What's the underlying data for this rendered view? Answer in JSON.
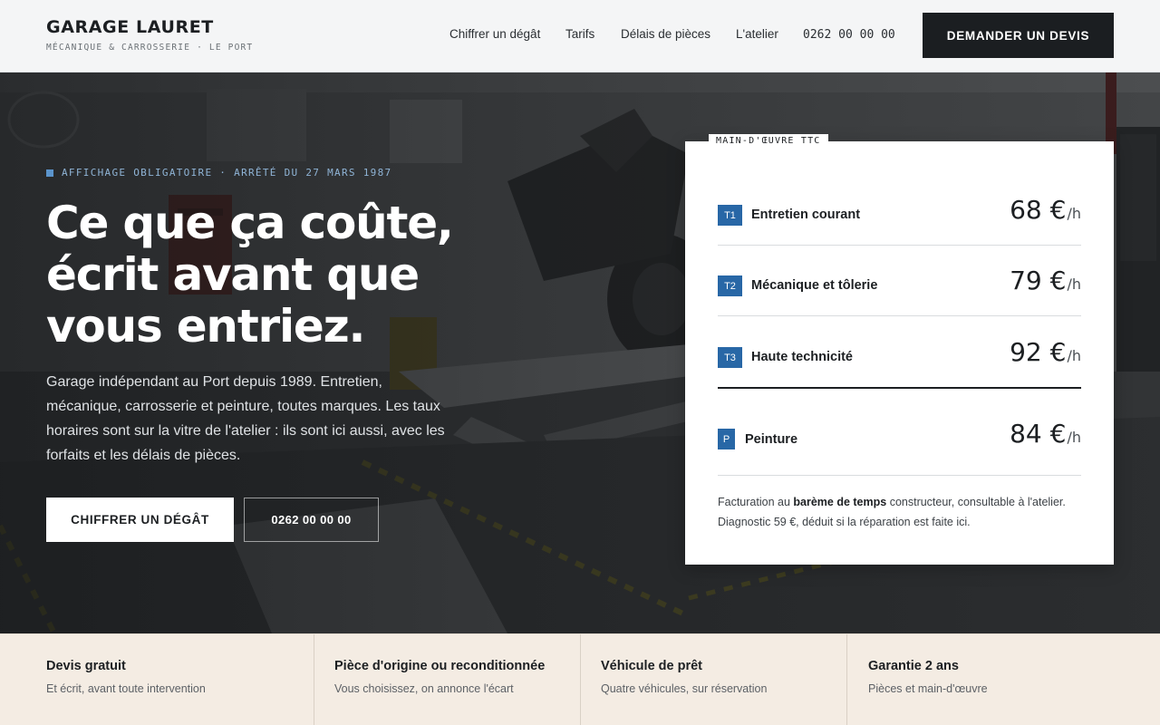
{
  "brand": {
    "name": "GARAGE LAURET",
    "tagline": "MÉCANIQUE & CARROSSERIE · LE PORT"
  },
  "nav": {
    "items": [
      "Chiffrer un dégât",
      "Tarifs",
      "Délais de pièces",
      "L'atelier"
    ],
    "phone": "0262 00 00 00",
    "cta": "DEMANDER UN DEVIS"
  },
  "hero": {
    "kicker": "AFFICHAGE OBLIGATOIRE · ARRÊTÉ DU 27 MARS 1987",
    "headline_line1": "Ce que ça coûte,",
    "headline_line2": "écrit avant que",
    "headline_line3": "vous entriez.",
    "intro": "Garage indépendant au Port depuis 1989. Entretien, mécanique, carrosserie et peinture, toutes marques. Les taux horaires sont sur la vitre de l'atelier : ils sont ici aussi, avec les forfaits et les délais de pièces.",
    "primary_button": "CHIFFRER UN DÉGÂT",
    "phone_button": "0262 00 00 00"
  },
  "rates": {
    "tag": "MAIN-D'ŒUVRE TTC",
    "unit": "/h",
    "currency": "€",
    "rows": [
      {
        "code": "T1",
        "label": "Entretien courant",
        "price": "68"
      },
      {
        "code": "T2",
        "label": "Mécanique et tôlerie",
        "price": "79"
      },
      {
        "code": "T3",
        "label": "Haute technicité",
        "price": "92"
      },
      {
        "code": "P",
        "label": "Peinture",
        "price": "84"
      }
    ],
    "note_before": "Facturation au ",
    "note_bold": "barème de temps",
    "note_after": " constructeur, consultable à l'atelier.",
    "note_line2": "Diagnostic 59 €, déduit si la réparation est faite ici."
  },
  "features": [
    {
      "title": "Devis gratuit",
      "sub": "Et écrit, avant toute intervention"
    },
    {
      "title": "Pièce d'origine ou reconditionnée",
      "sub": "Vous choisissez, on annonce l'écart"
    },
    {
      "title": "Véhicule de prêt",
      "sub": "Quatre véhicules, sur réservation"
    },
    {
      "title": "Garantie 2 ans",
      "sub": "Pièces et main-d'œuvre"
    }
  ],
  "colors": {
    "accent": "#2867a6",
    "dark": "#1b1e21",
    "feature_bg": "#f4ece3"
  }
}
